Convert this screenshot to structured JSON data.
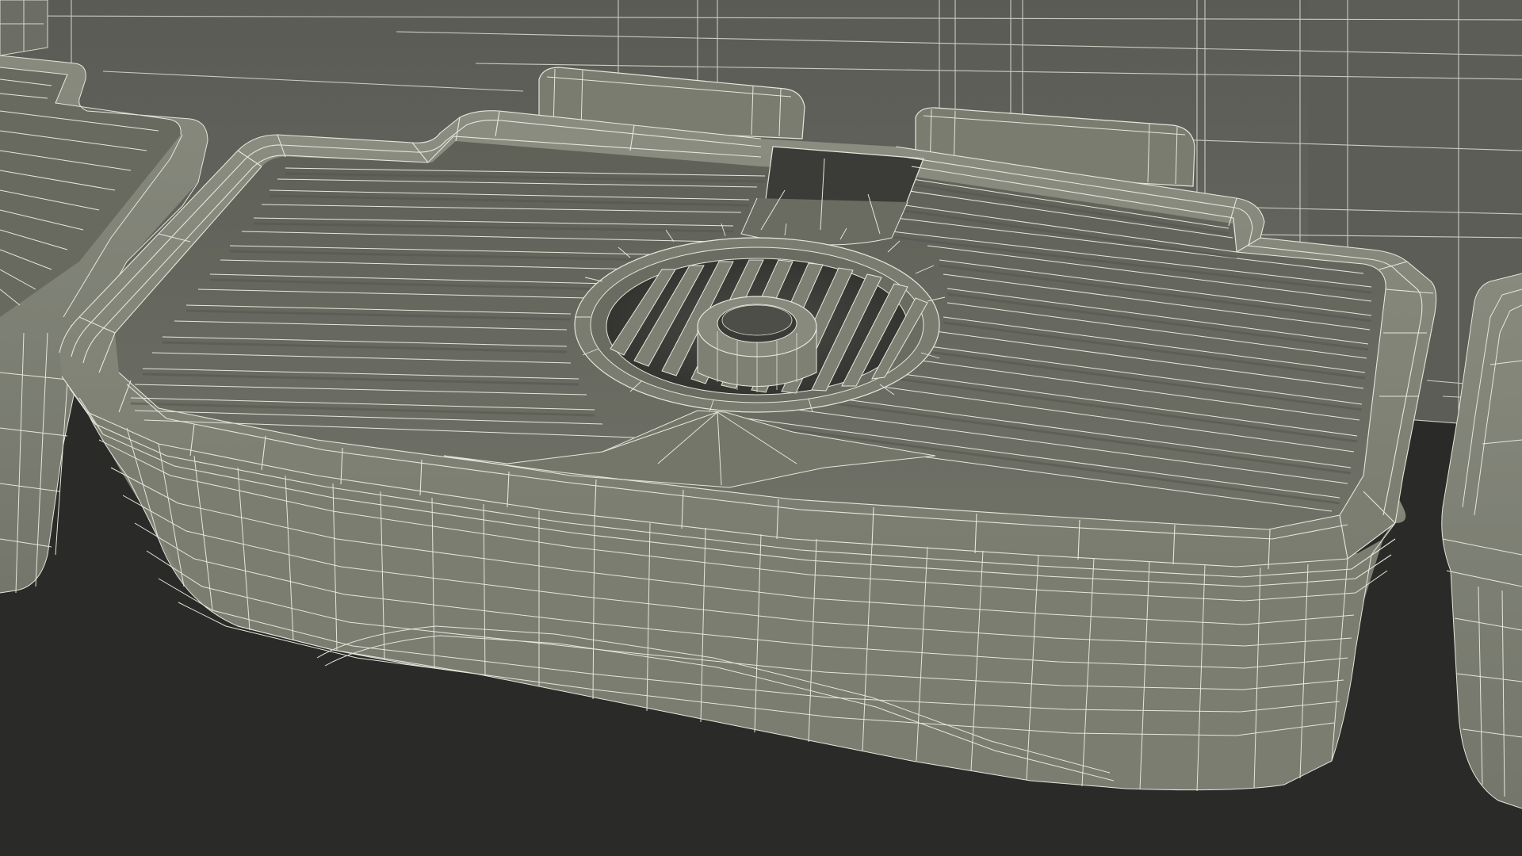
{
  "scene": {
    "subject": "wireframe-3d-render",
    "palette": {
      "background": "#2a2a28",
      "back_wall": "#61625c",
      "back_wall_dark": "#4f504b",
      "tray_body": "#7b7d71",
      "tray_body_dark": "#6b6d62",
      "tray_top": "#6e7066",
      "ridge_light": "#85877b",
      "ridge_dark": "#55574f",
      "recess_dark": "#3a3b36",
      "wire": "#e6e6dc"
    }
  }
}
